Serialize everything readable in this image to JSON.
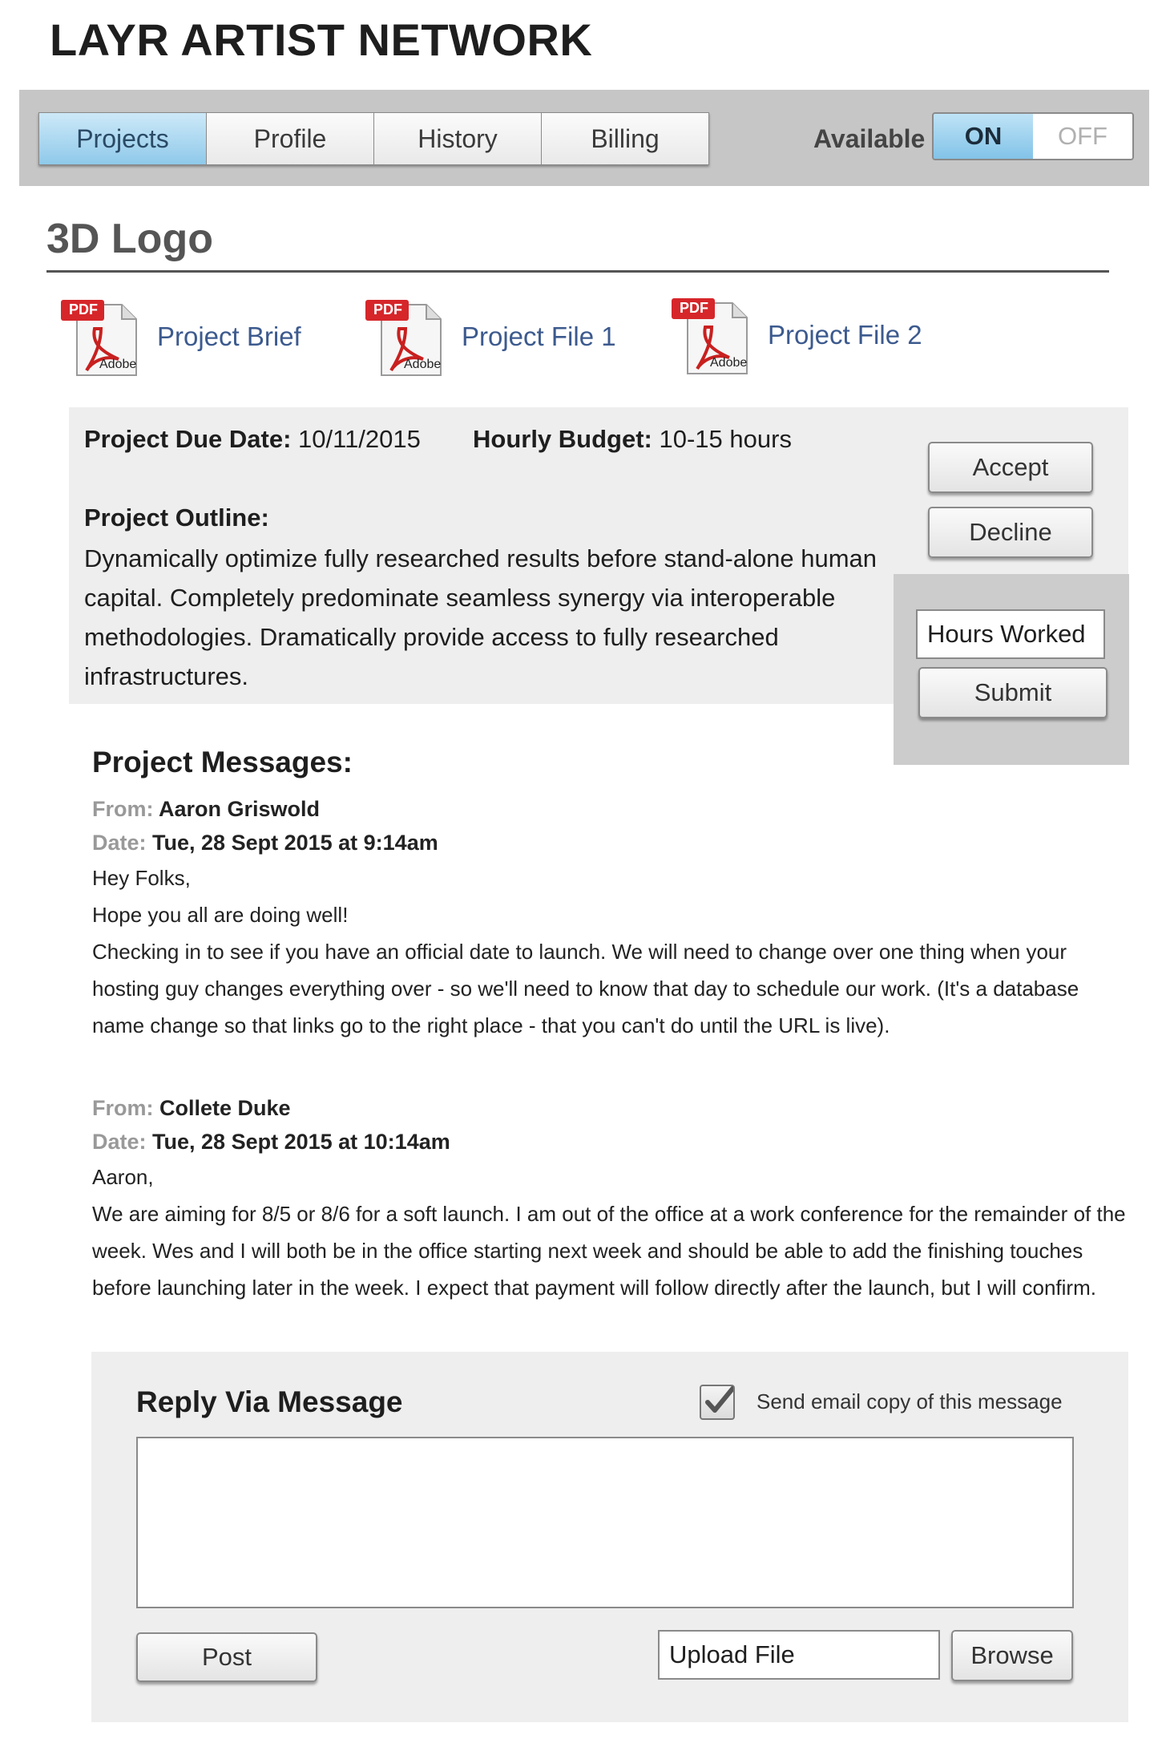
{
  "app": {
    "title": "LAYR ARTIST NETWORK"
  },
  "nav": {
    "tabs": [
      {
        "label": "Projects",
        "active": true
      },
      {
        "label": "Profile",
        "active": false
      },
      {
        "label": "History",
        "active": false
      },
      {
        "label": "Billing",
        "active": false
      }
    ],
    "availability": {
      "label": "Available",
      "on_label": "ON",
      "off_label": "OFF",
      "state": "ON"
    }
  },
  "project": {
    "title": "3D Logo",
    "attachments": [
      {
        "label": "Project Brief",
        "icon": "pdf-icon",
        "badge": "PDF",
        "brand": "Adobe"
      },
      {
        "label": "Project File 1",
        "icon": "pdf-icon",
        "badge": "PDF",
        "brand": "Adobe"
      },
      {
        "label": "Project File 2",
        "icon": "pdf-icon",
        "badge": "PDF",
        "brand": "Adobe"
      }
    ],
    "due_date_label": "Project Due Date:",
    "due_date": "10/11/2015",
    "budget_label": "Hourly Budget:",
    "budget": "10-15 hours",
    "outline_label": "Project Outline:",
    "outline": "Dynamically optimize fully researched results before stand-alone human capital. Completely predominate seamless synergy via interoperable methodologies. Dramatically provide access to fully researched infrastructures.",
    "actions": {
      "accept_label": "Accept",
      "decline_label": "Decline",
      "hours_placeholder": "Hours Worked",
      "submit_label": "Submit"
    }
  },
  "messages": {
    "heading": "Project Messages:",
    "from_label": "From:",
    "date_label": "Date:",
    "items": [
      {
        "from": "Aaron Griswold",
        "date": "Tue, 28 Sept 2015 at 9:14am",
        "lines": [
          "Hey Folks,",
          "Hope you all are doing well!",
          "Checking in to see if you have an official date to launch. We will need to change over one thing when your hosting guy changes everything over - so we'll need to know that day to schedule our work. (It's a database name change so that links go to the right place - that you can't do until the URL is live)."
        ]
      },
      {
        "from": "Collete Duke",
        "date": "Tue, 28 Sept 2015 at 10:14am",
        "lines": [
          "Aaron,",
          "We are aiming for 8/5 or 8/6 for a soft launch. I am out of the office at a work conference for the remainder of the week. Wes and I will both be in the office starting next week and should be able to add the finishing touches before launching later in the week. I expect that payment will follow directly after the launch, but I will confirm."
        ]
      }
    ]
  },
  "reply": {
    "heading": "Reply Via Message",
    "email_copy_label": "Send email copy of this message",
    "email_copy_checked": true,
    "post_label": "Post",
    "upload_placeholder": "Upload File",
    "browse_label": "Browse"
  },
  "colors": {
    "active_tab": "#8fc9ea",
    "link": "#3c5a8e",
    "panel": "#eeeeee",
    "topbar": "#c6c6c6"
  }
}
